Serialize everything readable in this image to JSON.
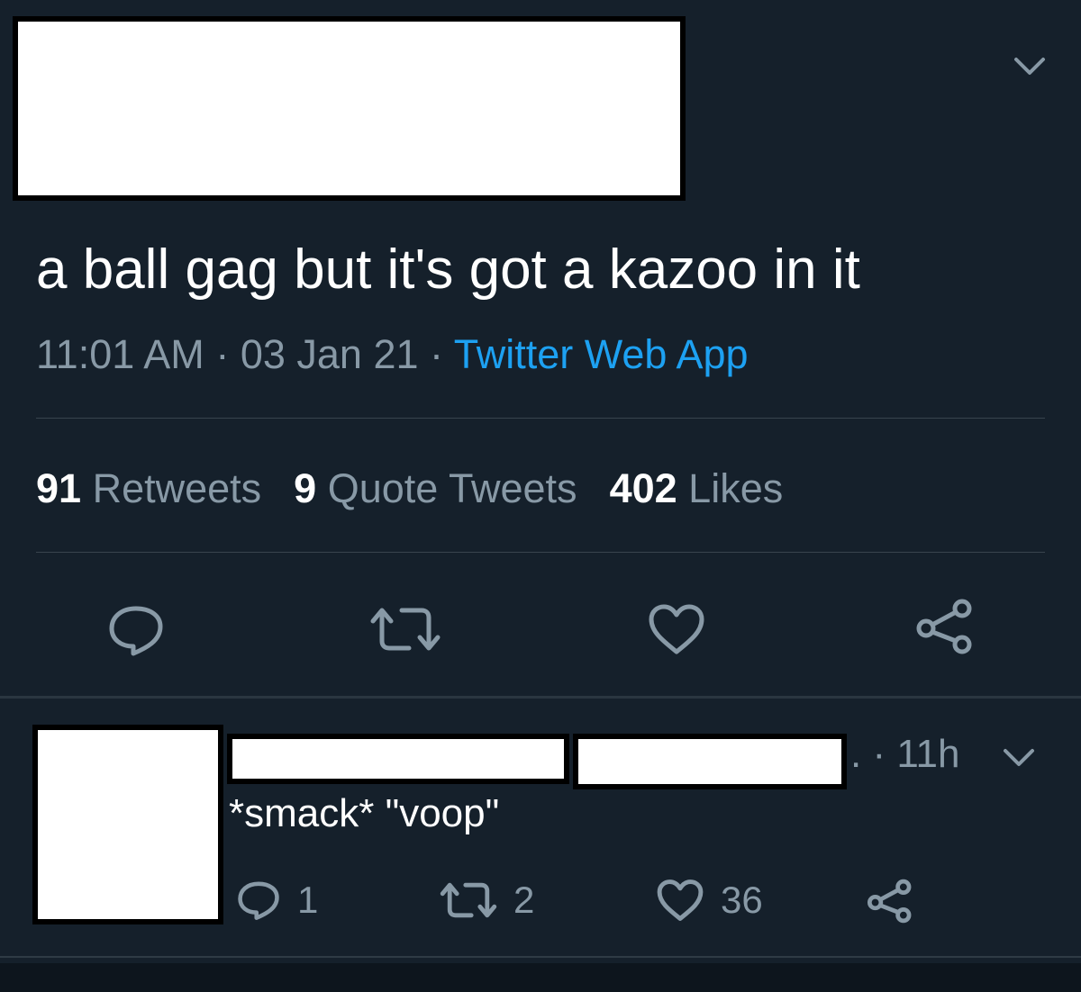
{
  "tweet": {
    "text": "a ball gag but it's got a kazoo in it",
    "time": "11:01 AM",
    "date": "03 Jan 21",
    "separator": "·",
    "source": "Twitter Web App",
    "stats": {
      "retweets_count": "91",
      "retweets_label": "Retweets",
      "quotes_count": "9",
      "quotes_label": "Quote Tweets",
      "likes_count": "402",
      "likes_label": "Likes"
    }
  },
  "reply": {
    "time_prefix": ". ·",
    "time": "11h",
    "text": "*smack* \"voop\"",
    "reply_count": "1",
    "retweet_count": "2",
    "like_count": "36"
  },
  "colors": {
    "background": "#15202b",
    "text_primary": "#ffffff",
    "text_secondary": "#8899a6",
    "accent": "#1da1f2",
    "divider": "#38444d"
  },
  "icons": [
    "chevron-down-icon",
    "reply-icon",
    "retweet-icon",
    "like-icon",
    "share-icon"
  ]
}
